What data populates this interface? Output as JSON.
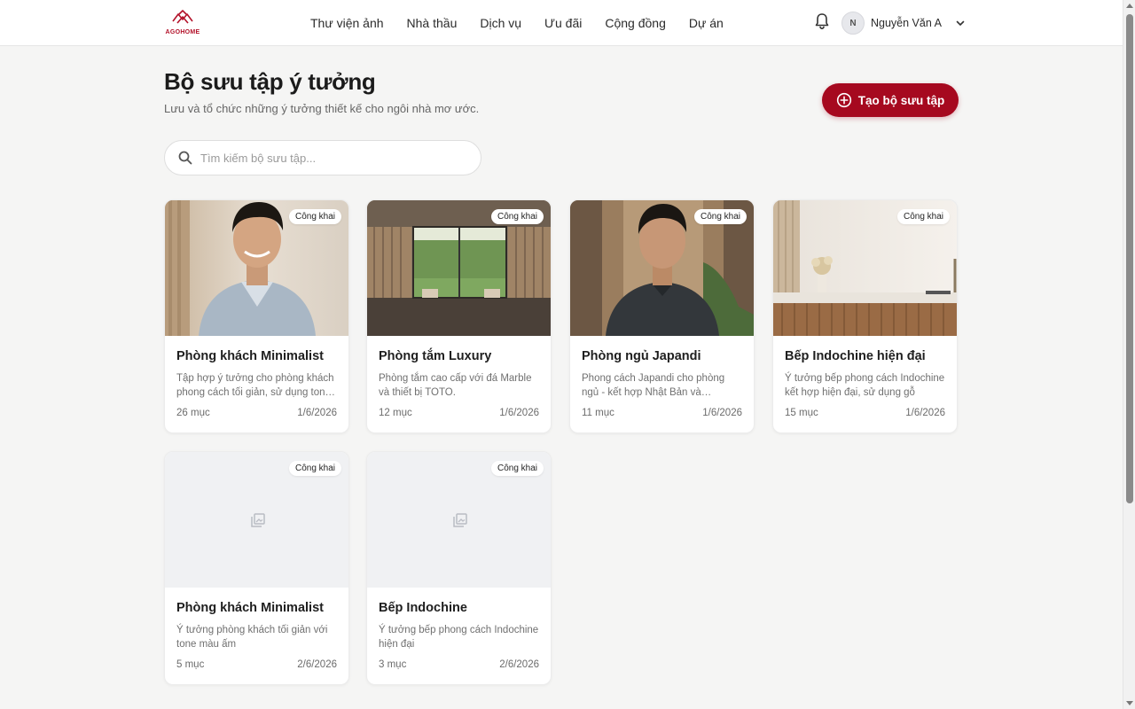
{
  "header": {
    "logo_text": "AGOHOME",
    "nav": [
      "Thư viện ảnh",
      "Nhà thầu",
      "Dịch vụ",
      "Ưu đãi",
      "Cộng đồng",
      "Dự án"
    ],
    "user": {
      "initial": "N",
      "name": "Nguyễn Văn A"
    }
  },
  "page": {
    "title": "Bộ sưu tập ý tưởng",
    "subtitle": "Lưu và tổ chức những ý tưởng thiết kế cho ngôi nhà mơ ước.",
    "create_label": "Tạo bộ sưu tập",
    "search_placeholder": "Tìm kiếm bộ sưu tập..."
  },
  "collections": [
    {
      "title": "Phòng khách Minimalist",
      "desc": "Tập hợp ý tưởng cho phòng khách phong cách tối giản, sử dụng tone màu ấm",
      "count": "26 mục",
      "date": "1/6/2026",
      "badge": "Công khai",
      "image": "portrait-man-light-shirt"
    },
    {
      "title": "Phòng tắm Luxury",
      "desc": "Phòng tắm cao cấp với đá Marble và thiết bị TOTO.",
      "count": "12 mục",
      "date": "1/6/2026",
      "badge": "Công khai",
      "image": "interior-glass-doors"
    },
    {
      "title": "Phòng ngủ Japandi",
      "desc": "Phong cách Japandi cho phòng ngủ - kết hợp Nhật Bản và Scandinavian",
      "count": "11 mục",
      "date": "1/6/2026",
      "badge": "Công khai",
      "image": "portrait-man-dark-shirt"
    },
    {
      "title": "Bếp Indochine hiện đại",
      "desc": "Ý tưởng bếp phong cách Indochine kết hợp hiện đại, sử dụng gỗ",
      "count": "15 mục",
      "date": "1/6/2026",
      "badge": "Công khai",
      "image": "kitchen-counter"
    },
    {
      "title": "Phòng khách Minimalist",
      "desc": "Ý tưởng phòng khách tối giản với tone màu ấm",
      "count": "5 mục",
      "date": "2/6/2026",
      "badge": "Công khai",
      "image": "placeholder-image-icon"
    },
    {
      "title": "Bếp Indochine",
      "desc": "Ý tưởng bếp phong cách Indochine hiện đại",
      "count": "3 mục",
      "date": "2/6/2026",
      "badge": "Công khai",
      "image": "placeholder-image-icon"
    }
  ],
  "colors": {
    "brand": "#a6091f",
    "background": "#f5f5f4"
  }
}
